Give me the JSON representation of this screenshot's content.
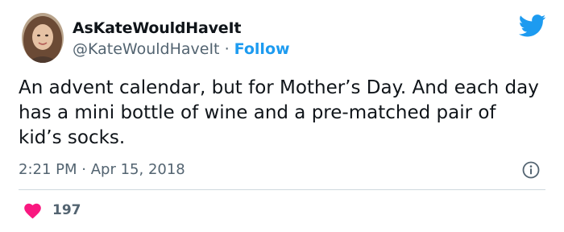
{
  "user": {
    "display_name": "AsKateWouldHaveIt",
    "handle": "@KateWouldHaveIt",
    "separator": "·",
    "follow_label": "Follow"
  },
  "tweet": {
    "text": "An advent calendar, but for Mother’s Day. And each day has a mini bottle of wine and a pre-matched pair of kid’s socks.",
    "time": "2:21 PM",
    "date_separator": "·",
    "date": "Apr 15, 2018"
  },
  "engagement": {
    "likes": "197"
  },
  "icons": {
    "brand": "twitter-bird-icon",
    "info": "info-icon",
    "like": "heart-icon"
  },
  "colors": {
    "accent": "#1d9bf0",
    "heart": "#f91880",
    "secondary_text": "#536471"
  }
}
